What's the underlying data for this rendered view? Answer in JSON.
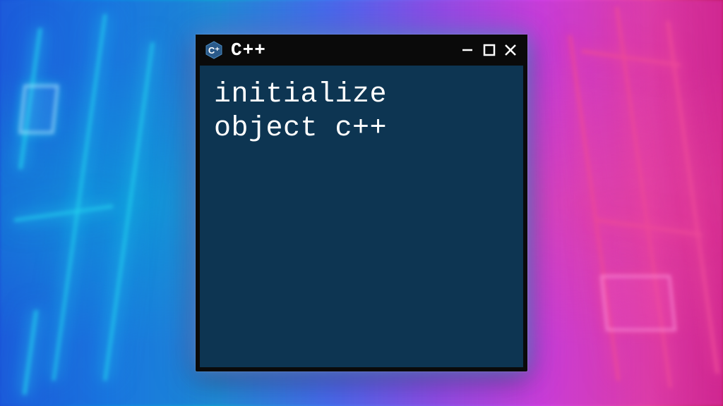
{
  "window": {
    "title": "C++",
    "icon_name": "cpp-logo-icon",
    "body_text": "initialize\nobject c++",
    "colors": {
      "titlebar_bg": "#0a0a0a",
      "body_bg": "#0d3552",
      "text": "#ffffff"
    }
  },
  "controls": {
    "minimize": "minimize",
    "maximize": "maximize",
    "close": "close"
  }
}
